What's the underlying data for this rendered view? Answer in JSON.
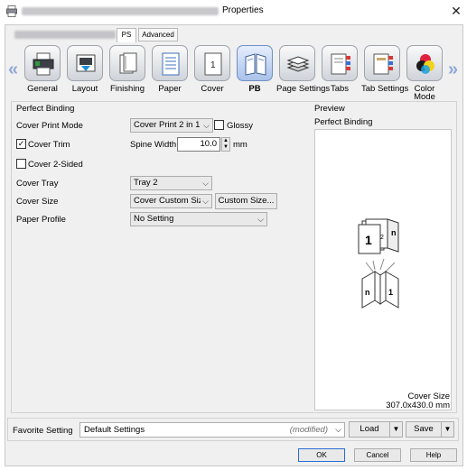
{
  "window": {
    "title": "Properties",
    "close_symbol": "✕"
  },
  "tabs": [
    {
      "label": "PS",
      "active": true
    },
    {
      "label": "Advanced",
      "active": false
    }
  ],
  "icon_nav": {
    "items": [
      {
        "label": "General",
        "icon": "printer-icon"
      },
      {
        "label": "Layout",
        "icon": "layout-icon"
      },
      {
        "label": "Finishing",
        "icon": "finishing-icon"
      },
      {
        "label": "Paper",
        "icon": "paper-icon"
      },
      {
        "label": "Cover",
        "icon": "cover-icon"
      },
      {
        "label": "PB",
        "icon": "perfect-binding-icon",
        "active": true
      },
      {
        "label": "Page Settings",
        "icon": "page-settings-icon"
      },
      {
        "label": "Tabs",
        "icon": "tabs-icon"
      },
      {
        "label": "Tab Settings",
        "icon": "tab-settings-icon"
      },
      {
        "label": "Color Mode",
        "icon": "color-mode-icon"
      }
    ],
    "color_mode_line1": "Color",
    "color_mode_line2": "Mode"
  },
  "perfect_binding": {
    "section_title": "Perfect Binding",
    "cover_print_mode_label": "Cover Print Mode",
    "cover_print_mode_value": "Cover Print 2 in 1",
    "glossy_label": "Glossy",
    "glossy_checked": false,
    "cover_trim_label": "Cover Trim",
    "cover_trim_checked": true,
    "spine_width_label": "Spine Width",
    "spine_width_value": "10.0",
    "spine_width_unit": "mm",
    "cover_2sided_label": "Cover 2-Sided",
    "cover_2sided_checked": false,
    "cover_tray_label": "Cover Tray",
    "cover_tray_value": "Tray 2",
    "cover_size_label": "Cover Size",
    "cover_size_value": "Cover Custom Size",
    "custom_size_button": "Custom Size...",
    "paper_profile_label": "Paper Profile",
    "paper_profile_value": "No Setting"
  },
  "preview": {
    "section_title": "Preview",
    "subtitle": "Perfect Binding",
    "cover_size_label": "Cover Size",
    "cover_size_value": "307.0x430.0 mm"
  },
  "favorite": {
    "label": "Favorite Setting",
    "value": "Default Settings",
    "modified": "(modified)",
    "load_label": "Load",
    "save_label": "Save"
  },
  "buttons": {
    "ok": "OK",
    "cancel": "Cancel",
    "help": "Help"
  },
  "colors": {
    "accent_blue": "#2a6cd6",
    "nav_arrow": "#8fa9d6"
  }
}
